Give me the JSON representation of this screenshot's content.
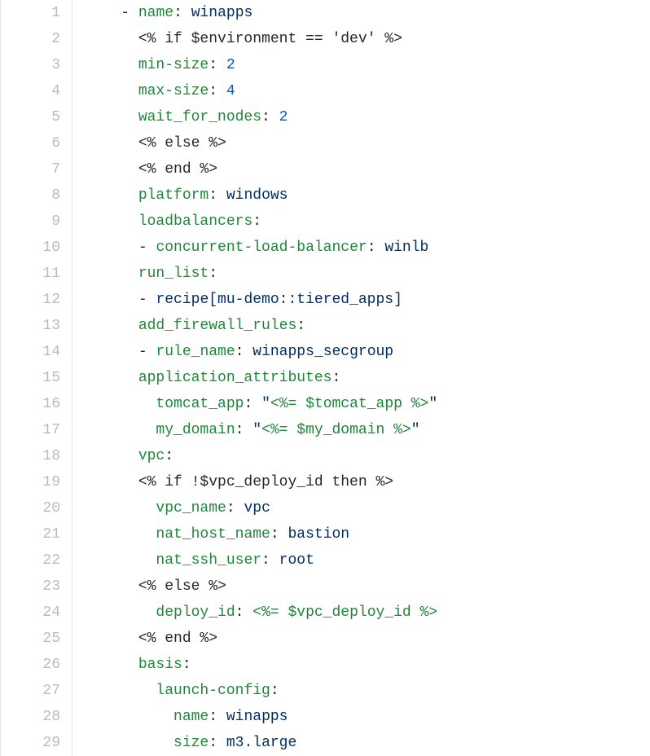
{
  "lines": [
    {
      "num": "1",
      "tokens": [
        {
          "t": "    ",
          "c": "pl"
        },
        {
          "t": "-",
          "c": "pl"
        },
        {
          "t": " ",
          "c": "pl"
        },
        {
          "t": "name",
          "c": "key"
        },
        {
          "t": ":",
          "c": "pl"
        },
        {
          "t": " ",
          "c": "pl"
        },
        {
          "t": "winapps",
          "c": "str"
        }
      ]
    },
    {
      "num": "2",
      "tokens": [
        {
          "t": "      ",
          "c": "pl"
        },
        {
          "t": "<% if $environment == 'dev' %>",
          "c": "pl"
        }
      ]
    },
    {
      "num": "3",
      "tokens": [
        {
          "t": "      ",
          "c": "pl"
        },
        {
          "t": "min-size",
          "c": "key"
        },
        {
          "t": ":",
          "c": "pl"
        },
        {
          "t": " ",
          "c": "pl"
        },
        {
          "t": "2",
          "c": "num"
        }
      ]
    },
    {
      "num": "4",
      "tokens": [
        {
          "t": "      ",
          "c": "pl"
        },
        {
          "t": "max-size",
          "c": "key"
        },
        {
          "t": ":",
          "c": "pl"
        },
        {
          "t": " ",
          "c": "pl"
        },
        {
          "t": "4",
          "c": "num"
        }
      ]
    },
    {
      "num": "5",
      "tokens": [
        {
          "t": "      ",
          "c": "pl"
        },
        {
          "t": "wait_for_nodes",
          "c": "key"
        },
        {
          "t": ":",
          "c": "pl"
        },
        {
          "t": " ",
          "c": "pl"
        },
        {
          "t": "2",
          "c": "num"
        }
      ]
    },
    {
      "num": "6",
      "tokens": [
        {
          "t": "      ",
          "c": "pl"
        },
        {
          "t": "<% else %>",
          "c": "pl"
        }
      ]
    },
    {
      "num": "7",
      "tokens": [
        {
          "t": "      ",
          "c": "pl"
        },
        {
          "t": "<% end %>",
          "c": "pl"
        }
      ]
    },
    {
      "num": "8",
      "tokens": [
        {
          "t": "      ",
          "c": "pl"
        },
        {
          "t": "platform",
          "c": "key"
        },
        {
          "t": ":",
          "c": "pl"
        },
        {
          "t": " ",
          "c": "pl"
        },
        {
          "t": "windows",
          "c": "str"
        }
      ]
    },
    {
      "num": "9",
      "tokens": [
        {
          "t": "      ",
          "c": "pl"
        },
        {
          "t": "loadbalancers",
          "c": "key"
        },
        {
          "t": ":",
          "c": "pl"
        }
      ]
    },
    {
      "num": "10",
      "tokens": [
        {
          "t": "      ",
          "c": "pl"
        },
        {
          "t": "-",
          "c": "pl"
        },
        {
          "t": " ",
          "c": "pl"
        },
        {
          "t": "concurrent-load-balancer",
          "c": "key"
        },
        {
          "t": ":",
          "c": "pl"
        },
        {
          "t": " ",
          "c": "pl"
        },
        {
          "t": "winlb",
          "c": "str"
        }
      ]
    },
    {
      "num": "11",
      "tokens": [
        {
          "t": "      ",
          "c": "pl"
        },
        {
          "t": "run_list",
          "c": "key"
        },
        {
          "t": ":",
          "c": "pl"
        }
      ]
    },
    {
      "num": "12",
      "tokens": [
        {
          "t": "      ",
          "c": "pl"
        },
        {
          "t": "-",
          "c": "pl"
        },
        {
          "t": " ",
          "c": "pl"
        },
        {
          "t": "recipe[mu-demo::tiered_apps]",
          "c": "str"
        }
      ]
    },
    {
      "num": "13",
      "tokens": [
        {
          "t": "      ",
          "c": "pl"
        },
        {
          "t": "add_firewall_rules",
          "c": "key"
        },
        {
          "t": ":",
          "c": "pl"
        }
      ]
    },
    {
      "num": "14",
      "tokens": [
        {
          "t": "      ",
          "c": "pl"
        },
        {
          "t": "-",
          "c": "pl"
        },
        {
          "t": " ",
          "c": "pl"
        },
        {
          "t": "rule_name",
          "c": "key"
        },
        {
          "t": ":",
          "c": "pl"
        },
        {
          "t": " ",
          "c": "pl"
        },
        {
          "t": "winapps_secgroup",
          "c": "str"
        }
      ]
    },
    {
      "num": "15",
      "tokens": [
        {
          "t": "      ",
          "c": "pl"
        },
        {
          "t": "application_attributes",
          "c": "key"
        },
        {
          "t": ":",
          "c": "pl"
        }
      ]
    },
    {
      "num": "16",
      "tokens": [
        {
          "t": "        ",
          "c": "pl"
        },
        {
          "t": "tomcat_app",
          "c": "key"
        },
        {
          "t": ":",
          "c": "pl"
        },
        {
          "t": " ",
          "c": "pl"
        },
        {
          "t": "\"",
          "c": "str"
        },
        {
          "t": "<%= $tomcat_app %>",
          "c": "key"
        },
        {
          "t": "\"",
          "c": "str"
        }
      ]
    },
    {
      "num": "17",
      "tokens": [
        {
          "t": "        ",
          "c": "pl"
        },
        {
          "t": "my_domain",
          "c": "key"
        },
        {
          "t": ":",
          "c": "pl"
        },
        {
          "t": " ",
          "c": "pl"
        },
        {
          "t": "\"",
          "c": "str"
        },
        {
          "t": "<%= $my_domain %>",
          "c": "key"
        },
        {
          "t": "\"",
          "c": "str"
        }
      ]
    },
    {
      "num": "18",
      "tokens": [
        {
          "t": "      ",
          "c": "pl"
        },
        {
          "t": "vpc",
          "c": "key"
        },
        {
          "t": ":",
          "c": "pl"
        }
      ]
    },
    {
      "num": "19",
      "tokens": [
        {
          "t": "      ",
          "c": "pl"
        },
        {
          "t": "<% if !$vpc_deploy_id then %>",
          "c": "pl"
        }
      ]
    },
    {
      "num": "20",
      "tokens": [
        {
          "t": "        ",
          "c": "pl"
        },
        {
          "t": "vpc_name",
          "c": "key"
        },
        {
          "t": ":",
          "c": "pl"
        },
        {
          "t": " ",
          "c": "pl"
        },
        {
          "t": "vpc",
          "c": "str"
        }
      ]
    },
    {
      "num": "21",
      "tokens": [
        {
          "t": "        ",
          "c": "pl"
        },
        {
          "t": "nat_host_name",
          "c": "key"
        },
        {
          "t": ":",
          "c": "pl"
        },
        {
          "t": " ",
          "c": "pl"
        },
        {
          "t": "bastion",
          "c": "str"
        }
      ]
    },
    {
      "num": "22",
      "tokens": [
        {
          "t": "        ",
          "c": "pl"
        },
        {
          "t": "nat_ssh_user",
          "c": "key"
        },
        {
          "t": ":",
          "c": "pl"
        },
        {
          "t": " ",
          "c": "pl"
        },
        {
          "t": "root",
          "c": "str"
        }
      ]
    },
    {
      "num": "23",
      "tokens": [
        {
          "t": "      ",
          "c": "pl"
        },
        {
          "t": "<% else %>",
          "c": "pl"
        }
      ]
    },
    {
      "num": "24",
      "tokens": [
        {
          "t": "        ",
          "c": "pl"
        },
        {
          "t": "deploy_id",
          "c": "key"
        },
        {
          "t": ":",
          "c": "pl"
        },
        {
          "t": " ",
          "c": "pl"
        },
        {
          "t": "<%= $vpc_deploy_id %>",
          "c": "key"
        }
      ]
    },
    {
      "num": "25",
      "tokens": [
        {
          "t": "      ",
          "c": "pl"
        },
        {
          "t": "<% end %>",
          "c": "pl"
        }
      ]
    },
    {
      "num": "26",
      "tokens": [
        {
          "t": "      ",
          "c": "pl"
        },
        {
          "t": "basis",
          "c": "key"
        },
        {
          "t": ":",
          "c": "pl"
        }
      ]
    },
    {
      "num": "27",
      "tokens": [
        {
          "t": "        ",
          "c": "pl"
        },
        {
          "t": "launch-config",
          "c": "key"
        },
        {
          "t": ":",
          "c": "pl"
        }
      ]
    },
    {
      "num": "28",
      "tokens": [
        {
          "t": "          ",
          "c": "pl"
        },
        {
          "t": "name",
          "c": "key"
        },
        {
          "t": ":",
          "c": "pl"
        },
        {
          "t": " ",
          "c": "pl"
        },
        {
          "t": "winapps",
          "c": "str"
        }
      ]
    },
    {
      "num": "29",
      "tokens": [
        {
          "t": "          ",
          "c": "pl"
        },
        {
          "t": "size",
          "c": "key"
        },
        {
          "t": ":",
          "c": "pl"
        },
        {
          "t": " ",
          "c": "pl"
        },
        {
          "t": "m3.large",
          "c": "str"
        }
      ]
    }
  ]
}
